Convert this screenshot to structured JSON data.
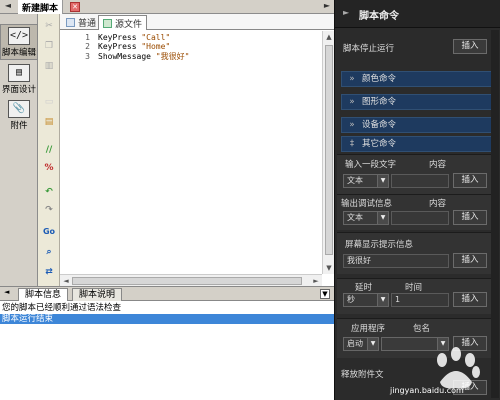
{
  "tabbar": {
    "doc_title": "新建脚本",
    "left_arrow": "◄",
    "right_arrow": "►"
  },
  "left_panel": {
    "items": [
      {
        "label": "脚本编辑",
        "icon": "</>"
      },
      {
        "label": "界面设计",
        "icon": "▤"
      },
      {
        "label": "附件",
        "icon": "📎"
      }
    ]
  },
  "editor": {
    "tabs": {
      "normal": "普通",
      "source": "源文件"
    },
    "lines": [
      {
        "num": "1",
        "cmd": "KeyPress ",
        "arg": "\"Call\""
      },
      {
        "num": "2",
        "cmd": "KeyPress ",
        "arg": "\"Home\""
      },
      {
        "num": "3",
        "cmd": "ShowMessage ",
        "arg": "\"我很好\""
      }
    ]
  },
  "bottom": {
    "tabs": {
      "info": "脚本信息",
      "desc": "脚本说明"
    },
    "messages": [
      "您的脚本已经顺利通过语法检查",
      "脚本运行结束"
    ]
  },
  "right_panel": {
    "title": "脚本命令",
    "stop_label": "脚本停止运行",
    "insert": "插入",
    "categories": [
      "颜色命令",
      "图形命令",
      "设备命令",
      "其它命令"
    ],
    "input_text": {
      "label": "输入一段文字",
      "content_label": "内容",
      "type": "文本"
    },
    "debug": {
      "label": "输出调试信息",
      "content_label": "内容",
      "type": "文本"
    },
    "screen_msg": {
      "label": "屏幕显示提示信息",
      "value": "我很好"
    },
    "delay": {
      "label": "延时",
      "time_label": "时间",
      "unit": "秒",
      "value": "1"
    },
    "app": {
      "label": "应用程序",
      "pkg_label": "包名",
      "action": "启动"
    },
    "release": {
      "label": "释放附件文"
    }
  },
  "watermark": {
    "text": "jingyan.baidu.com"
  },
  "colors": {
    "right_bg": "#2b2b2b",
    "category_bg": "#1e3a5f",
    "selection": "#3d86d8",
    "chrome": "#d4d0c8"
  }
}
